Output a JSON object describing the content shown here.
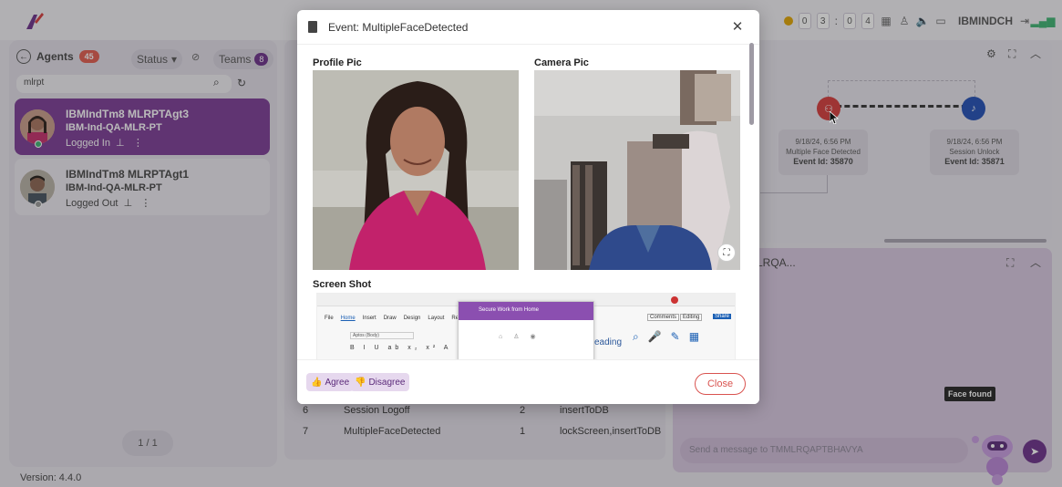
{
  "app": {
    "timer": [
      "0",
      "3",
      "0",
      "4"
    ],
    "username": "IBMINDCH",
    "version": "Version: 4.4.0"
  },
  "agents_panel": {
    "title": "Agents",
    "count": "45",
    "status_label": "Status",
    "teams_label": "Teams",
    "teams_count": "8",
    "search_value": "mlrpt",
    "agents": [
      {
        "name": "IBMIndTm8 MLRPTAgt3",
        "team": "IBM-Ind-QA-MLR-PT",
        "status": "Logged In",
        "status_color": "#3cb371"
      },
      {
        "name": "IBMIndTm8 MLRPTAgt1",
        "team": "IBM-Ind-QA-MLR-PT",
        "status": "Logged Out",
        "status_color": "#9a9a9a"
      }
    ],
    "pager": "1 / 1"
  },
  "event_flow": {
    "events": [
      {
        "time": "9/18/24, 6:56 PM",
        "name": "Multiple Face Detected",
        "id": "Event Id: 35870",
        "color": "#d63a3a"
      },
      {
        "time": "9/18/24, 6:56 PM",
        "name": "Session Unlock",
        "id": "Event Id: 35871",
        "color": "#1f4db5"
      }
    ]
  },
  "event_table": {
    "rows": [
      {
        "num": "6",
        "event": "Session Logoff",
        "count": "2",
        "action": "insertToDB"
      },
      {
        "num": "7",
        "event": "MultipleFaceDetected",
        "count": "1",
        "action": "lockScreen,insertToDB"
      }
    ]
  },
  "chat": {
    "header": "LRQA...",
    "placeholder": "Send a message to TMMLRQAPTBHAVYA",
    "tooltip": "Face found"
  },
  "modal": {
    "title": "Event: MultipleFaceDetected",
    "profile_label": "Profile Pic",
    "camera_label": "Camera Pic",
    "screenshot_label": "Screen Shot",
    "agree_label": "Agree",
    "disagree_label": "Disagree",
    "close_label": "Close",
    "screenshot": {
      "menu": [
        "File",
        "Home",
        "Insert",
        "Draw",
        "Design",
        "Layout",
        "Reference"
      ],
      "dialog_title": "Secure Work from Home",
      "comments": "Comments",
      "editing": "Editing",
      "share": "Share",
      "font": "Aptos (Body)",
      "heading": "eading"
    }
  },
  "colors": {
    "brand": "#6a2f89",
    "accent_red": "#d9534f"
  }
}
